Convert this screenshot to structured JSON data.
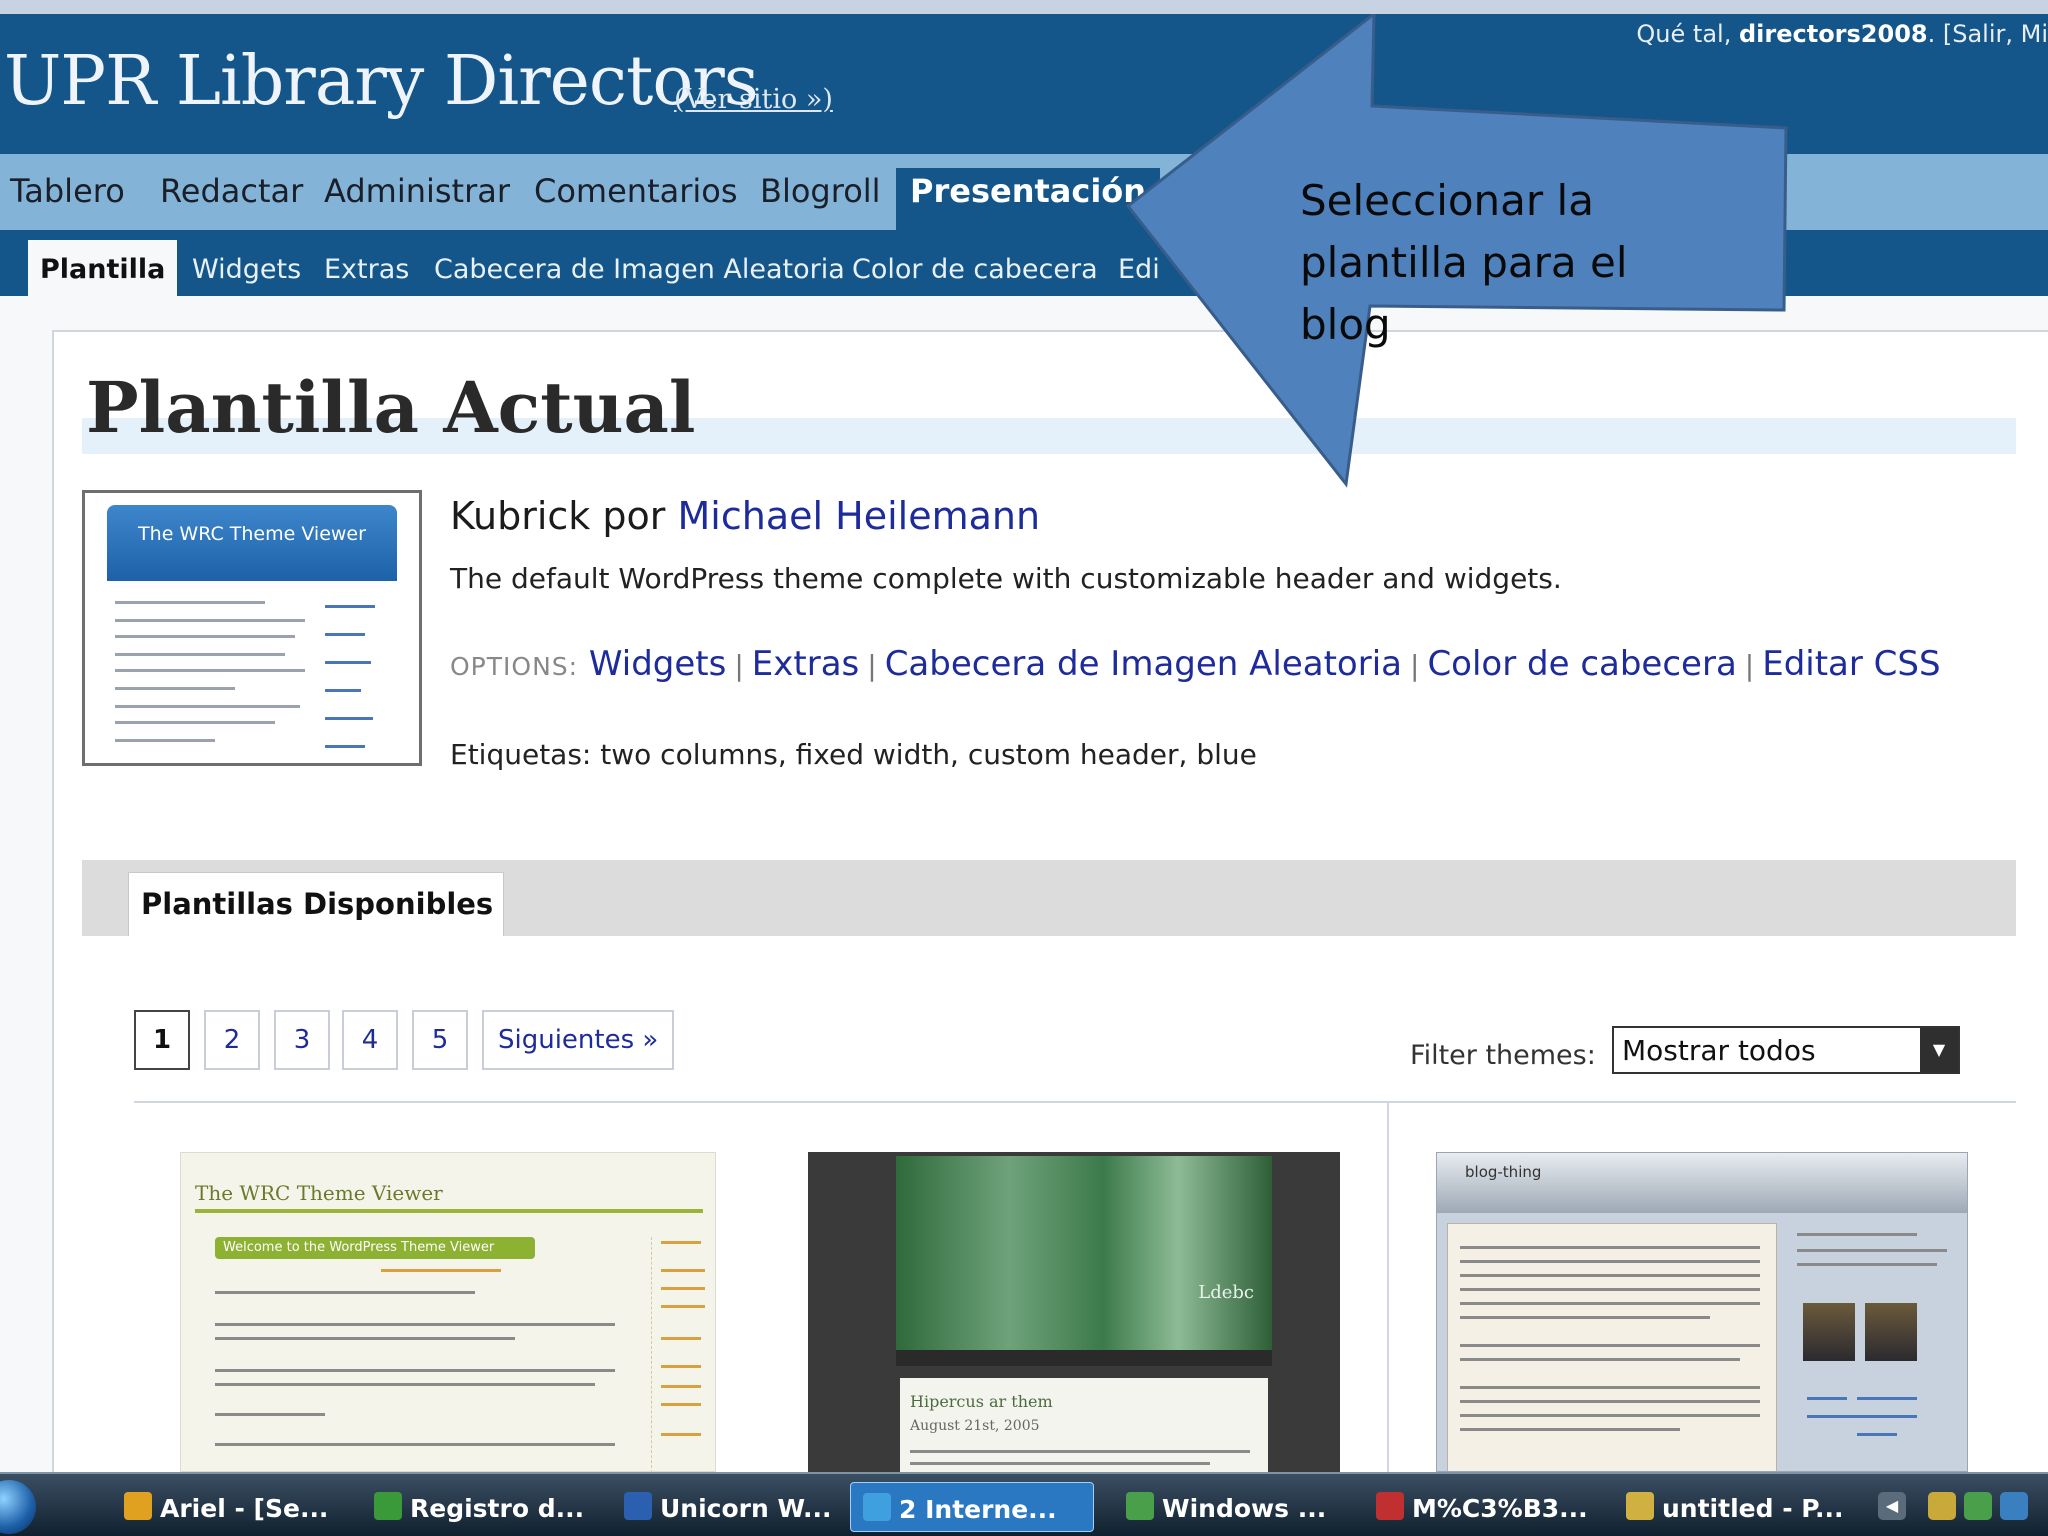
{
  "header": {
    "site_title": "UPR Library Directors",
    "view_site": "(Ver sitio »)",
    "greeting_prefix": "Qué tal,",
    "username": "directors2008",
    "greeting_suffix": ". [Salir, Mi"
  },
  "main_nav": {
    "items": [
      "Tablero",
      "Redactar",
      "Administrar",
      "Comentarios",
      "Blogroll",
      "Presentación"
    ],
    "active": "Presentación"
  },
  "sub_nav": {
    "items": [
      "Plantilla",
      "Widgets",
      "Extras",
      "Cabecera de Imagen Aleatoria",
      "Color de cabecera",
      "Edi"
    ],
    "active": "Plantilla"
  },
  "current_theme": {
    "heading": "Plantilla Actual",
    "thumbnail_title": "The WRC Theme Viewer",
    "name": "Kubrick",
    "by": "por",
    "author": "Michael Heilemann",
    "description": "The default WordPress theme complete with customizable header and widgets.",
    "options_label": "OPTIONS:",
    "options": [
      "Widgets",
      "Extras",
      "Cabecera de Imagen Aleatoria",
      "Color de cabecera",
      "Editar CSS"
    ],
    "tags_label": "Etiquetas:",
    "tags": "two columns, fixed width, custom header, blue"
  },
  "available": {
    "tab_label": "Plantillas Disponibles",
    "pages": [
      "1",
      "2",
      "3",
      "4",
      "5"
    ],
    "current_page": "1",
    "next_label": "Siguientes »",
    "filter_label": "Filter themes:",
    "filter_value": "Mostrar todos",
    "previews": [
      {
        "title": "The WRC Theme Viewer",
        "banner": "Welcome to the WordPress Theme Viewer"
      },
      {
        "banner_title": "Ldebc",
        "post_title": "Hipercus ar them",
        "post_date": "August 21st, 2005"
      },
      {
        "title": "blog-thing"
      }
    ]
  },
  "callout": {
    "text": "Seleccionar la plantilla  para el blog",
    "fill": "#4f81bd",
    "stroke": "#385d8a"
  },
  "taskbar": {
    "tasks": [
      {
        "label": "Ariel - [Se...",
        "icon": "ariel-app-icon",
        "color": "#e0a020"
      },
      {
        "label": "Registro d...",
        "icon": "spreadsheet-icon",
        "color": "#3a9a3a"
      },
      {
        "label": "Unicorn W...",
        "icon": "word-doc-icon",
        "color": "#2b5fb0"
      },
      {
        "label": "2 Interne...",
        "icon": "internet-explorer-icon",
        "color": "#3fa0e0",
        "active": true
      },
      {
        "label": "Windows ...",
        "icon": "windows-messenger-icon",
        "color": "#4aa04a"
      },
      {
        "label": "M%C3%B3...",
        "icon": "pdf-doc-icon",
        "color": "#c03030"
      },
      {
        "label": "untitled - P...",
        "icon": "paint-icon",
        "color": "#d0b040"
      }
    ]
  },
  "colors": {
    "header_bg": "#14568a",
    "nav_bg": "#83b4d8",
    "link": "#1d2b9b"
  }
}
